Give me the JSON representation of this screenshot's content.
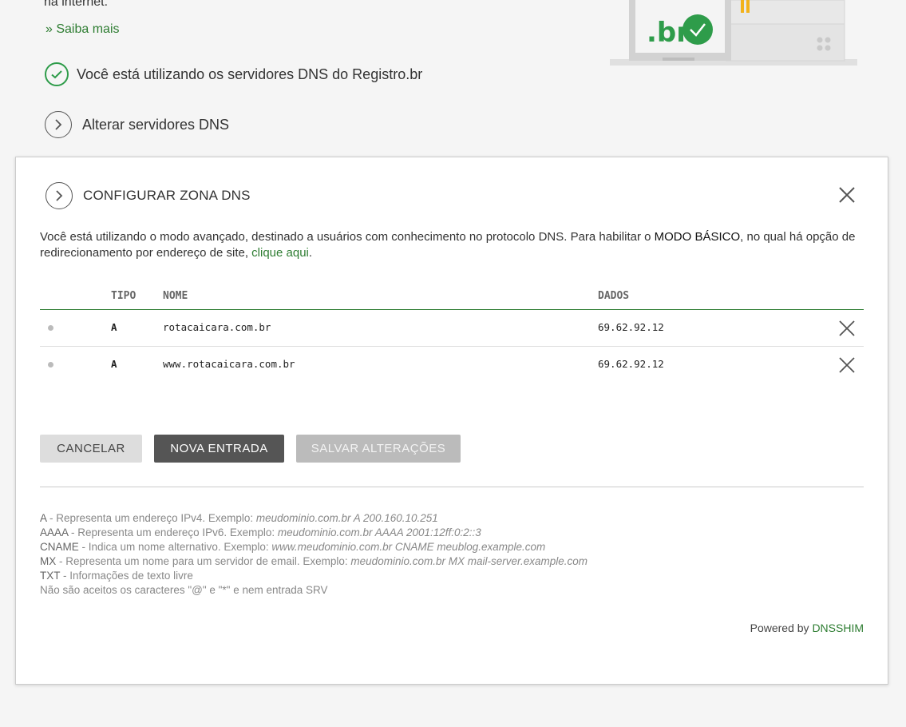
{
  "top": {
    "partial_text": "na internet.",
    "saiba_mais": "» Saiba mais",
    "status_text": "Você está utilizando os servidores DNS do Registro.br",
    "alterar_label": "Alterar servidores DNS"
  },
  "modal": {
    "title": "CONFIGURAR ZONA DNS",
    "intro_part1": "Você está utilizando o modo avançado, destinado a usuários com conhecimento no protocolo DNS. Para habilitar o ",
    "intro_bold": "MODO BÁSICO",
    "intro_part2": ", no qual há opção de redirecionamento por endereço de site, ",
    "intro_link": "clique aqui",
    "intro_end": ".",
    "table": {
      "headers": {
        "tipo": "TIPO",
        "nome": "NOME",
        "dados": "DADOS"
      },
      "rows": [
        {
          "tipo": "A",
          "nome": "rotacaicara.com.br",
          "dados": "69.62.92.12"
        },
        {
          "tipo": "A",
          "nome": "www.rotacaicara.com.br",
          "dados": "69.62.92.12"
        }
      ]
    },
    "buttons": {
      "cancel": "CANCELAR",
      "new_entry": "NOVA ENTRADA",
      "save": "SALVAR ALTERAÇÕES"
    },
    "legend": [
      {
        "key": "A",
        "desc": " - Representa um endereço IPv4. Exemplo: ",
        "example": "meudominio.com.br A 200.160.10.251"
      },
      {
        "key": "AAAA",
        "desc": " - Representa um endereço IPv6. Exemplo: ",
        "example": "meudominio.com.br AAAA 2001:12ff:0:2::3"
      },
      {
        "key": "CNAME",
        "desc": " - Indica um nome alternativo. Exemplo: ",
        "example": "www.meudominio.com.br CNAME meublog.example.com"
      },
      {
        "key": "MX",
        "desc": " - Representa um nome para um servidor de email. Exemplo: ",
        "example": "meudominio.com.br MX mail-server.example.com"
      },
      {
        "key": "TXT",
        "desc": " - Informações de texto livre",
        "example": ""
      }
    ],
    "legend_note": "Não são aceitos os caracteres \"@\" e \"*\" e nem entrada SRV",
    "powered_by": "Powered by ",
    "powered_link": "DNSSHIM"
  },
  "illustration": {
    "logo_text": ".br"
  },
  "colors": {
    "accent": "#2e7d32",
    "check": "#2e9c4a"
  }
}
